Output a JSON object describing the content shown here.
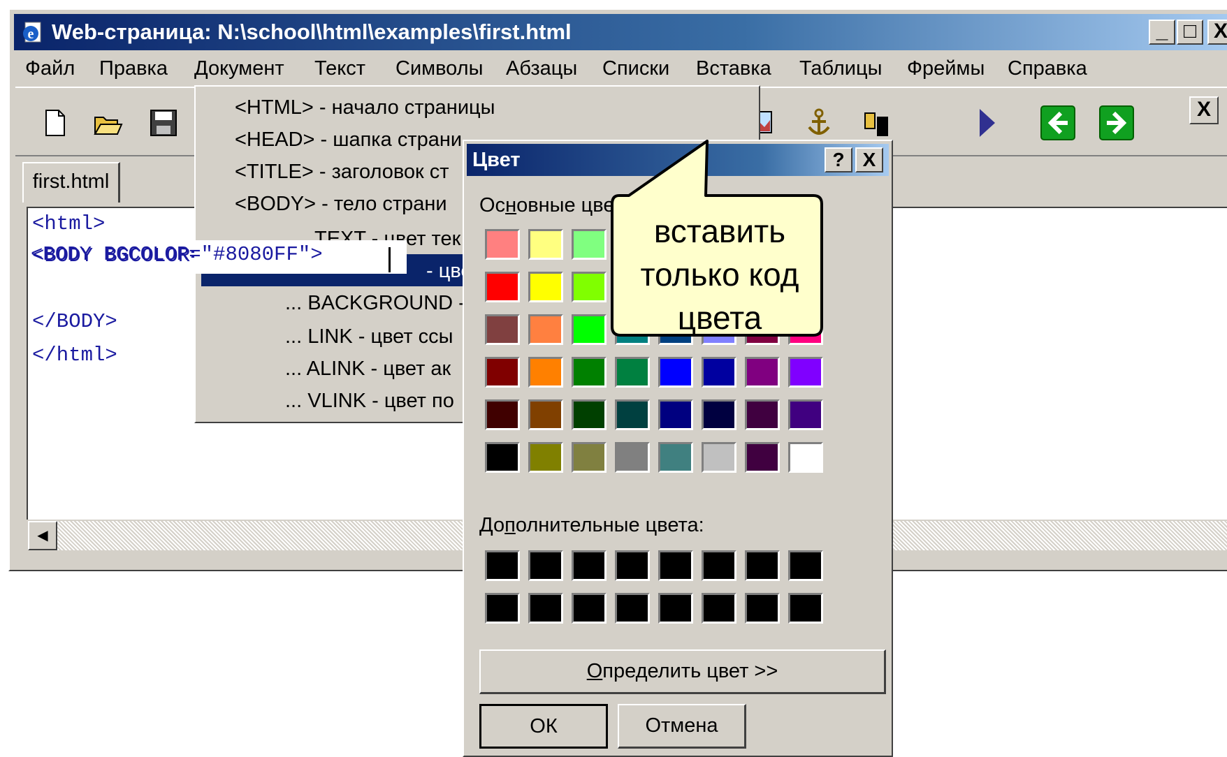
{
  "window": {
    "title": "Web-страница: N:\\school\\html\\examples\\first.html",
    "controls": {
      "minimize": "_",
      "maximize": "□",
      "close": "X"
    }
  },
  "menubar": [
    "Файл",
    "Правка",
    "Документ",
    "Текст",
    "Символы",
    "Абзацы",
    "Списки",
    "Вставка",
    "Таблицы",
    "Фреймы",
    "Справка"
  ],
  "toolbar": {
    "close": "X"
  },
  "tabs": [
    {
      "label": "first.html"
    }
  ],
  "editor": {
    "lines": [
      "<html>",
      "<BODY BGCOLOR=\"#8080FF\">",
      "",
      "</BODY>",
      "</html>"
    ]
  },
  "document_menu": {
    "items": [
      "<HTML> - начало страницы",
      "<HEAD> - шапка страницы",
      "<TITLE> - заголовок страницы",
      "<BODY> - тело страницы",
      "... TEXT - цвет текста",
      "... BGCOLOR - цвет фона",
      "... BACKGROUND - фоновый рисунок",
      "... LINK - цвет ссылок",
      "... ALINK - цвет активных ссылок",
      "... VLINK - цвет посещённых ссылок"
    ],
    "visible": [
      "<HTML> - начало страницы",
      "<HEAD> - шапка страни",
      "<TITLE> - заголовок ст",
      "<BODY> - тело страни",
      "TEXT - цвет тек",
      "- цве",
      "... BACKGROUND -",
      "... LINK - цвет ссы",
      "... ALINK - цвет ак",
      "... VLINK - цвет по"
    ]
  },
  "color_dialog": {
    "title": "Цвет",
    "help": "?",
    "close": "X",
    "basic_label": "Основные цвета:",
    "custom_label": "Дополнительные цвета:",
    "define_button": "Определить цвет >>",
    "ok_button": "ОК",
    "cancel_button": "Отмена",
    "basic_colors": [
      [
        "#ff8080",
        "#ffff80",
        "#80ff80",
        "#00ff80",
        "#80ffff",
        "#0080ff",
        "#ff80c0",
        "#ff80ff"
      ],
      [
        "#ff0000",
        "#ffff00",
        "#80ff00",
        "#00ff40",
        "#00ffff",
        "#0080c0",
        "#8080c0",
        "#ff00ff"
      ],
      [
        "#804040",
        "#ff8040",
        "#00ff00",
        "#008080",
        "#004080",
        "#8080ff",
        "#800040",
        "#ff0080"
      ],
      [
        "#800000",
        "#ff8000",
        "#008000",
        "#008040",
        "#0000ff",
        "#0000a0",
        "#800080",
        "#8000ff"
      ],
      [
        "#400000",
        "#804000",
        "#004000",
        "#004040",
        "#000080",
        "#000040",
        "#400040",
        "#400080"
      ],
      [
        "#000000",
        "#808000",
        "#808040",
        "#808080",
        "#408080",
        "#c0c0c0",
        "#400040",
        "#ffffff"
      ]
    ],
    "custom_colors": [
      [
        "#000000",
        "#000000",
        "#000000",
        "#000000",
        "#000000",
        "#000000",
        "#000000",
        "#000000"
      ],
      [
        "#000000",
        "#000000",
        "#000000",
        "#000000",
        "#000000",
        "#000000",
        "#000000",
        "#000000"
      ]
    ]
  },
  "callout": {
    "lines": [
      "вставить",
      "только код",
      "цвета"
    ]
  }
}
